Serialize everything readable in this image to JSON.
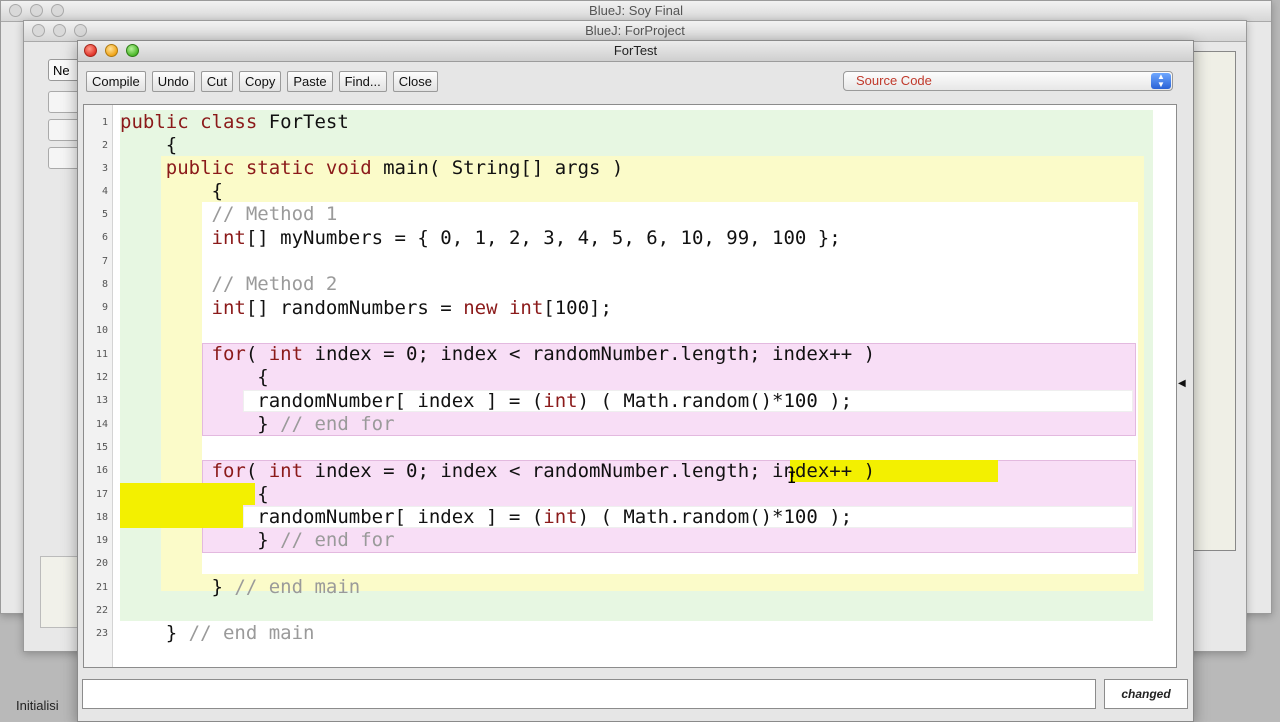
{
  "background_windows": {
    "back_title": "BlueJ:  Soy Final",
    "mid_title": "BlueJ:  ForProject",
    "left_button_label": "Ne",
    "left_status_text": "Initialisi"
  },
  "editor": {
    "title": "ForTest",
    "toolbar": {
      "compile": "Compile",
      "undo": "Undo",
      "cut": "Cut",
      "copy": "Copy",
      "paste": "Paste",
      "find": "Find...",
      "close": "Close"
    },
    "view_select": "Source Code",
    "status_message": "",
    "changed_label": "changed"
  },
  "code": {
    "line_numbers": [
      "1",
      "2",
      "3",
      "4",
      "5",
      "6",
      "7",
      "8",
      "9",
      "10",
      "11",
      "12",
      "13",
      "14",
      "15",
      "16",
      "17",
      "18",
      "19",
      "20",
      "21",
      "22",
      "23"
    ],
    "l1a": "public class",
    "l1b": " ForTest",
    "l2": "    {",
    "l3a": "    public static void",
    "l3b": " main( String[] args )",
    "l4": "        {",
    "l5": "        // Method 1",
    "l6a": "        int",
    "l6b": "[] myNumbers = { 0, 1, 2, 3, 4, 5, 6, 10, 99, 100 };",
    "l8": "        // Method 2",
    "l9a": "        int",
    "l9b": "[] randomNumbers = ",
    "l9c": "new int",
    "l9d": "[100];",
    "l11a": "        for",
    "l11b": "( ",
    "l11c": "int",
    "l11d": " index = 0; index < randomNumber.length; index++ )",
    "l12": "            {",
    "l13a": "            randomNumber[ index ] = (",
    "l13b": "int",
    "l13c": ") ( Math.random()*100 );",
    "l14a": "            }",
    "l14b": " // end for",
    "l16a": "        for",
    "l16b": "( ",
    "l16c": "int",
    "l16d": " index = 0; index < randomNumber.length; index++ )",
    "l17": "            {",
    "l18a": "            randomNumber[ index ] = (",
    "l18b": "int",
    "l18c": ") ( Math.random()*100 );",
    "l19a": "            }",
    "l19b": " // end for",
    "l21a": "        }",
    "l21b": " // end main",
    "l23a": "    }",
    "l23b": " // end main"
  },
  "colors": {
    "keyword": "#8b1a1a",
    "comment": "#9a9a9a",
    "class_scope": "#e7f7e2",
    "method_scope": "#fbfbc9",
    "loop_scope": "#f8def6",
    "highlight": "#f3f000"
  }
}
